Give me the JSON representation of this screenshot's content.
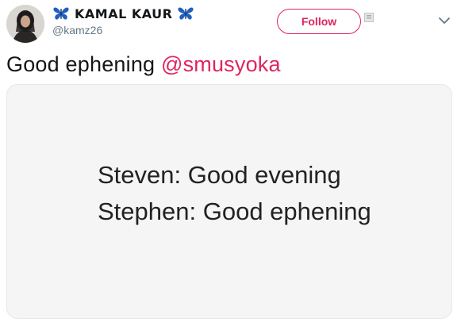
{
  "user": {
    "display_name": "KAMAL KAUR",
    "handle": "@kamz26",
    "avatar_icon": "profile-photo",
    "name_decoration_icon": "butterfly-icon"
  },
  "actions": {
    "follow_label": "Follow",
    "more_icon": "chevron-down-icon"
  },
  "tweet": {
    "text": "Good ephening ",
    "mention": "@smusyoka"
  },
  "media": {
    "lines": [
      "Steven: Good evening",
      "Stephen: Good ephening"
    ]
  },
  "colors": {
    "accent": "#e0245e",
    "butterfly": "#1f5fbf",
    "secondary_text": "#657786"
  }
}
